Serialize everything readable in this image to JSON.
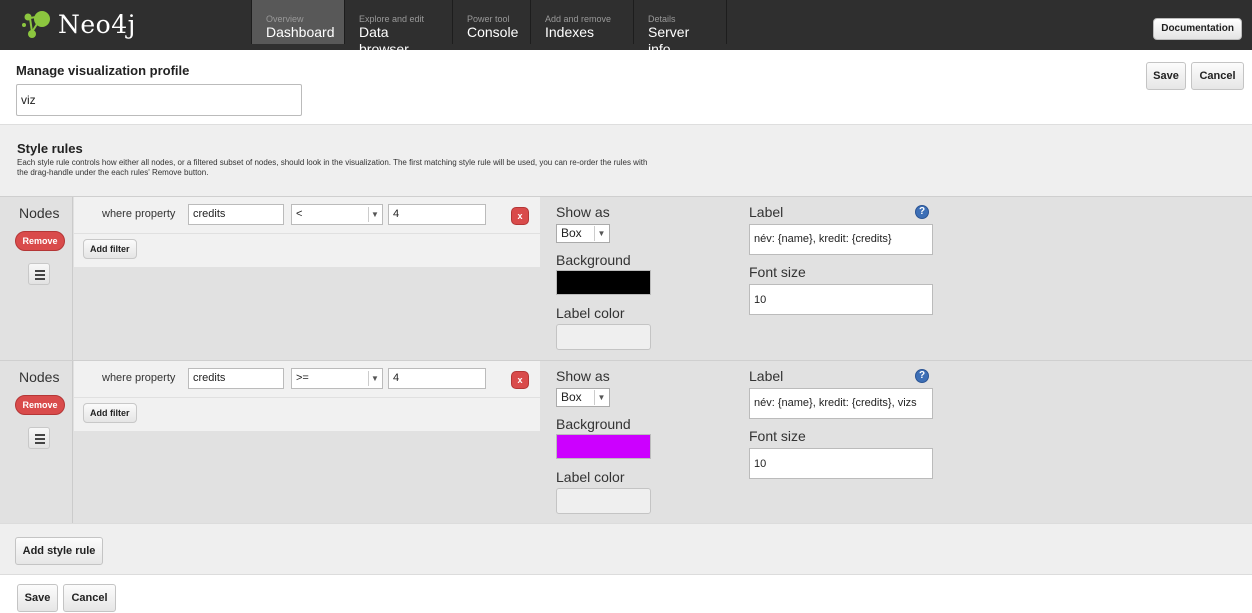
{
  "app": {
    "logo_text": "Neo4j"
  },
  "nav": [
    {
      "sub": "Overview",
      "main": "Dashboard",
      "active": true
    },
    {
      "sub": "Explore and edit",
      "main": "Data browser",
      "active": false
    },
    {
      "sub": "Power tool",
      "main": "Console",
      "active": false
    },
    {
      "sub": "Add and remove",
      "main": "Indexes",
      "active": false
    },
    {
      "sub": "Details",
      "main": "Server info",
      "active": false
    }
  ],
  "header": {
    "documentation_label": "Documentation"
  },
  "profile": {
    "title": "Manage visualization profile",
    "name_value": "viz",
    "save_label": "Save",
    "cancel_label": "Cancel"
  },
  "style_rules": {
    "title": "Style rules",
    "description": "Each style rule controls how either all nodes, or a filtered subset of nodes, should look in the visualization. The first matching style rule will be used, you can re-order the rules with the drag-handle under the each rules' Remove button.",
    "rules": [
      {
        "target": "Nodes",
        "remove_label": "Remove",
        "filter": {
          "where_label": "where property",
          "property": "credits",
          "operator": "<",
          "value": "4",
          "remove_filter_label": "x"
        },
        "add_filter_label": "Add filter",
        "show_as_label": "Show as",
        "shape": "Box",
        "background_label": "Background",
        "background_color": "#000000",
        "label_color_label": "Label color",
        "label_title": "Label",
        "label_value": "név: {name}, kredit: {credits}",
        "font_size_label": "Font size",
        "font_size_value": "10"
      },
      {
        "target": "Nodes",
        "remove_label": "Remove",
        "filter": {
          "where_label": "where property",
          "property": "credits",
          "operator": ">=",
          "value": "4",
          "remove_filter_label": "x"
        },
        "add_filter_label": "Add filter",
        "show_as_label": "Show as",
        "shape": "Box",
        "background_label": "Background",
        "background_color": "#cc00ff",
        "label_color_label": "Label color",
        "label_title": "Label",
        "label_value": "név: {name}, kredit: {credits}, vizs",
        "font_size_label": "Font size",
        "font_size_value": "10"
      }
    ],
    "add_rule_label": "Add style rule"
  },
  "footer": {
    "save_label": "Save",
    "cancel_label": "Cancel"
  },
  "colors": {
    "topbar": "#2f2f2f",
    "remove_red": "#d94b4b",
    "help_blue": "#3d6fb6"
  }
}
